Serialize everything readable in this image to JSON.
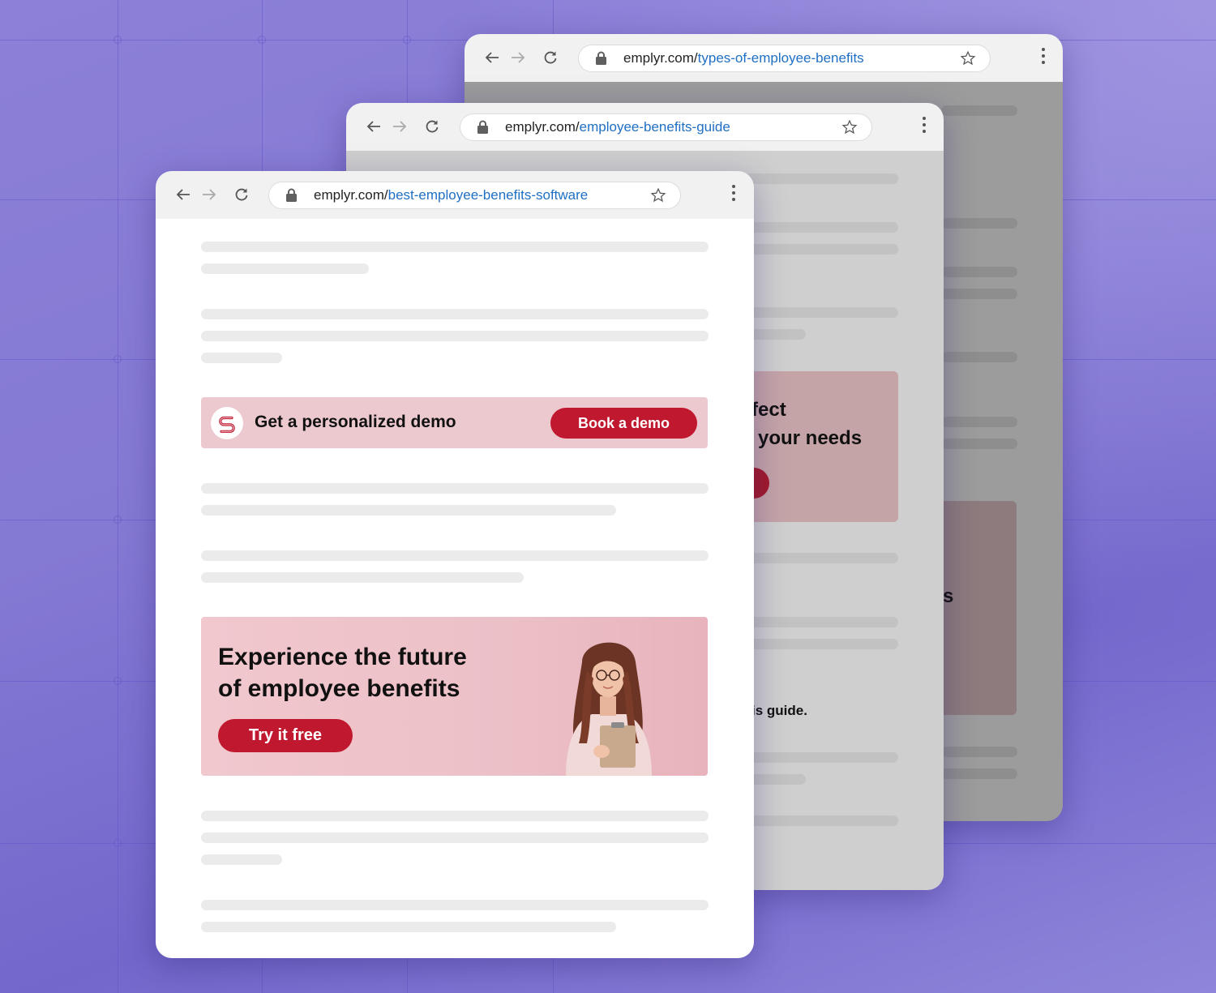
{
  "windows": {
    "back": {
      "url_domain": "emplyr.com/",
      "url_path": "types-of-employee-benefits",
      "partial_text": "s"
    },
    "middle": {
      "url_domain": "emplyr.com/",
      "url_path": "employee-benefits-guide",
      "banner_line1": "fect",
      "banner_line2": "your needs",
      "guide_text": "is guide."
    },
    "front": {
      "url_domain": "emplyr.com/",
      "url_path": "best-employee-benefits-software",
      "demo_banner": {
        "title": "Get a personalized demo",
        "button": "Book a demo",
        "logo": "emplyr-logo-icon"
      },
      "hero_banner": {
        "title_line1": "Experience the future",
        "title_line2": "of employee benefits",
        "button": "Try it free",
        "image": "woman-with-clipboard"
      }
    }
  },
  "icons": {
    "back": "arrow-left-icon",
    "forward": "arrow-right-icon",
    "reload": "reload-icon",
    "lock": "lock-icon",
    "bookmark": "star-icon",
    "menu": "kebab-menu-icon"
  },
  "colors": {
    "accent": "#c0192f",
    "banner_pink": "#ecc9cf",
    "link_blue": "#1f6fc4",
    "background_purple": "#8479d3"
  }
}
